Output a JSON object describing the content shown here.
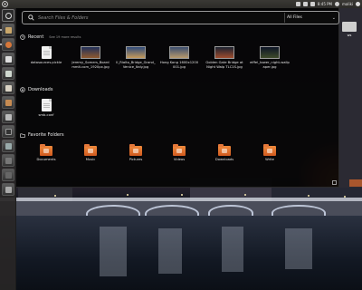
{
  "top_panel": {
    "clock": "8:45 PM",
    "user": "maliki"
  },
  "desktop": {
    "drive_label": "ws"
  },
  "search": {
    "placeholder": "Search Files & Folders",
    "filter_label": "All Files"
  },
  "recent": {
    "title": "Recent",
    "more": "See 19 more results",
    "items": [
      {
        "label": "datasources.pickle",
        "icon": "document-icon"
      },
      {
        "label": "Jeremy_Somers_Boardmmit.com_1920px.jpg",
        "icon": "image-thumbnail-icon"
      },
      {
        "label": "II_Rialto_Bridge_Grand_Venice_Italy.jpg",
        "icon": "image-thumbnail-icon"
      },
      {
        "label": "Hong Kong 1600x1200 001.jpg",
        "icon": "image-thumbnail-icon"
      },
      {
        "label": "Golden Gate Bridge at Night Walp TLC1S.jpg",
        "icon": "image-thumbnail-icon"
      },
      {
        "label": "eiffel_tower_night-wallpaper.jpg",
        "icon": "image-thumbnail-icon"
      }
    ]
  },
  "downloads": {
    "title": "Downloads",
    "items": [
      {
        "label": "smb.conf",
        "icon": "document-icon"
      }
    ]
  },
  "favorites": {
    "title": "Favorite Folders",
    "items": [
      {
        "label": "Documents",
        "icon": "documents-folder-icon"
      },
      {
        "label": "Music",
        "icon": "music-folder-icon"
      },
      {
        "label": "Pictures",
        "icon": "pictures-folder-icon"
      },
      {
        "label": "Videos",
        "icon": "videos-folder-icon"
      },
      {
        "label": "Downloads",
        "icon": "downloads-folder-icon"
      },
      {
        "label": "Write",
        "icon": "folder-icon"
      }
    ]
  },
  "colors": {
    "accent": "#e0692a",
    "dash_bg": "#050505",
    "panel_bg": "#3a3935"
  }
}
